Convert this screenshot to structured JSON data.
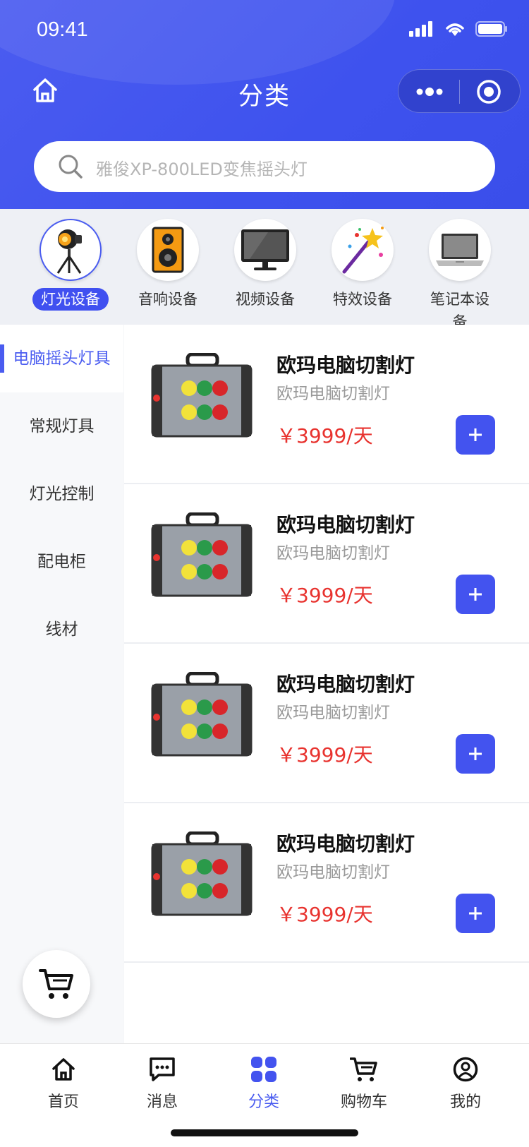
{
  "status": {
    "time": "09:41"
  },
  "header": {
    "title": "分类"
  },
  "search": {
    "placeholder": "雅俊XP-800LED变焦摇头灯"
  },
  "categories": [
    {
      "label": "灯光设备",
      "icon": "stage-light-icon",
      "active": true
    },
    {
      "label": "音响设备",
      "icon": "speaker-icon",
      "active": false
    },
    {
      "label": "视频设备",
      "icon": "monitor-icon",
      "active": false
    },
    {
      "label": "特效设备",
      "icon": "magic-wand-icon",
      "active": false
    },
    {
      "label": "笔记本设备",
      "icon": "laptop-icon",
      "active": false
    }
  ],
  "sidebar": {
    "items": [
      {
        "label": "电脑摇头灯具",
        "active": true
      },
      {
        "label": "常规灯具"
      },
      {
        "label": "灯光控制"
      },
      {
        "label": "配电柜"
      },
      {
        "label": "线材"
      }
    ]
  },
  "products": [
    {
      "name": "欧玛电脑切割灯",
      "subtitle": "欧玛电脑切割灯",
      "price": "￥3999/天"
    },
    {
      "name": "欧玛电脑切割灯",
      "subtitle": "欧玛电脑切割灯",
      "price": "￥3999/天"
    },
    {
      "name": "欧玛电脑切割灯",
      "subtitle": "欧玛电脑切割灯",
      "price": "￥3999/天"
    },
    {
      "name": "欧玛电脑切割灯",
      "subtitle": "欧玛电脑切割灯",
      "price": "￥3999/天"
    }
  ],
  "tabbar": {
    "items": [
      {
        "label": "首页",
        "icon": "home-icon"
      },
      {
        "label": "消息",
        "icon": "message-icon"
      },
      {
        "label": "分类",
        "icon": "category-icon",
        "active": true
      },
      {
        "label": "购物车",
        "icon": "cart-icon"
      },
      {
        "label": "我的",
        "icon": "user-icon"
      }
    ]
  },
  "colors": {
    "primary": "#4353ef",
    "price": "#e8332f",
    "header": "#4b5cf0"
  }
}
